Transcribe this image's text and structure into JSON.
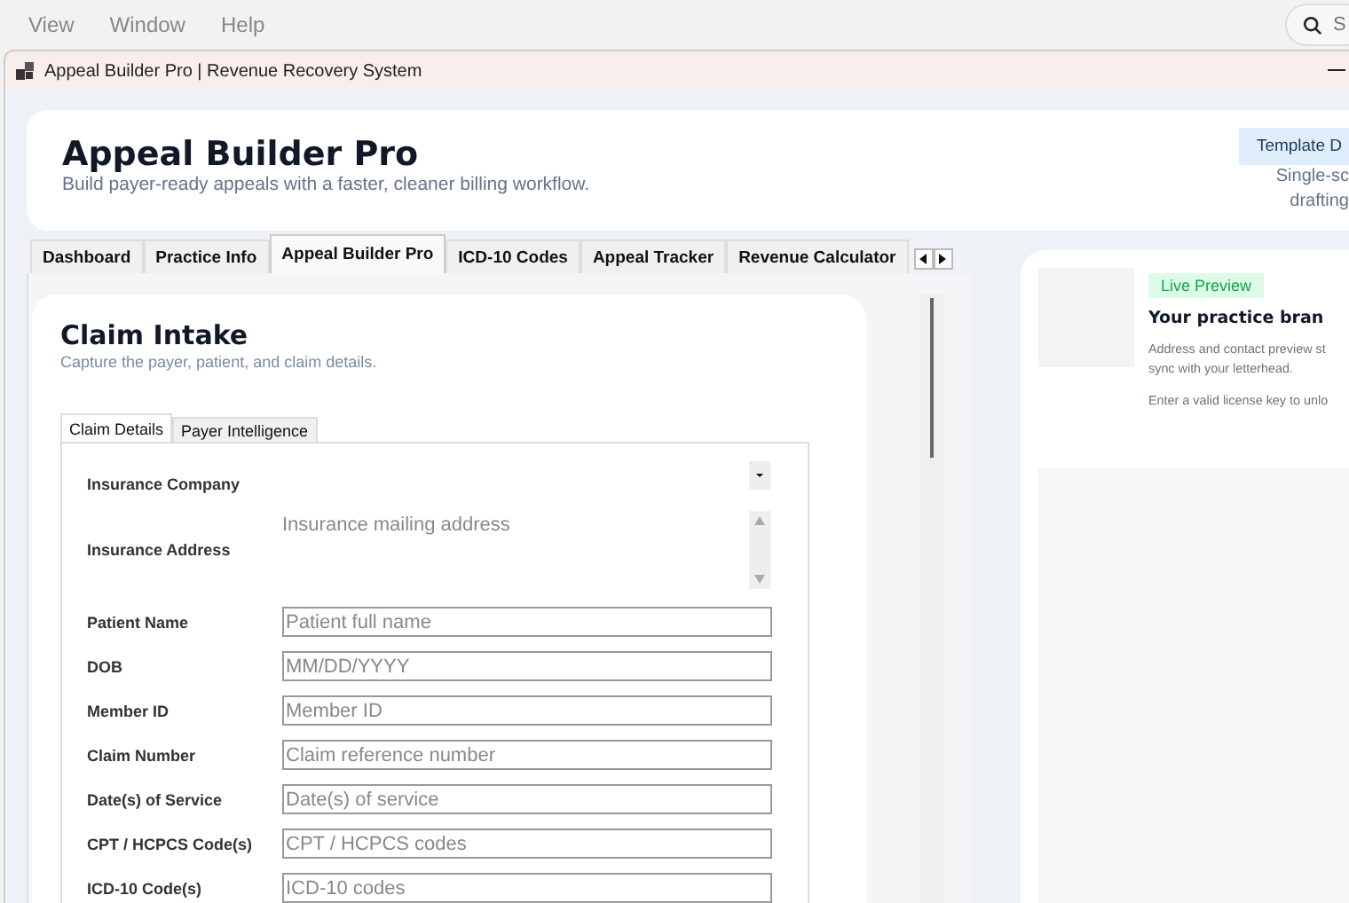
{
  "menu": [
    "View",
    "Window",
    "Help"
  ],
  "search": {
    "placeholder": "S"
  },
  "window": {
    "title": "Appeal Builder Pro | Revenue Recovery System"
  },
  "header": {
    "title": "Appeal Builder Pro",
    "subtitle": "Build payer-ready appeals with a faster, cleaner billing workflow.",
    "badge": "Template D",
    "notes": [
      "Single-sc",
      "drafting"
    ]
  },
  "tabs": [
    {
      "label": "Dashboard",
      "selected": false
    },
    {
      "label": "Practice Info",
      "selected": false
    },
    {
      "label": "Appeal Builder Pro",
      "selected": true
    },
    {
      "label": "ICD-10 Codes",
      "selected": false
    },
    {
      "label": "Appeal Tracker",
      "selected": false
    },
    {
      "label": "Revenue Calculator",
      "selected": false
    }
  ],
  "intake": {
    "title": "Claim Intake",
    "subtitle": "Capture the payer, patient, and claim details.",
    "subtabs": [
      {
        "label": "Claim Details",
        "selected": true
      },
      {
        "label": "Payer Intelligence",
        "selected": false
      }
    ],
    "fields": [
      {
        "label": "Insurance Company",
        "kind": "select"
      },
      {
        "label": "Insurance Address",
        "kind": "textarea",
        "placeholder": "Insurance mailing address"
      },
      {
        "label": "Patient Name",
        "kind": "text",
        "placeholder": "Patient full name"
      },
      {
        "label": "DOB",
        "kind": "text",
        "placeholder": "MM/DD/YYYY"
      },
      {
        "label": "Member ID",
        "kind": "text",
        "placeholder": "Member ID"
      },
      {
        "label": "Claim Number",
        "kind": "text",
        "placeholder": "Claim reference number"
      },
      {
        "label": "Date(s) of Service",
        "kind": "text",
        "placeholder": "Date(s) of service"
      },
      {
        "label": "CPT / HCPCS Code(s)",
        "kind": "text",
        "placeholder": "CPT / HCPCS codes"
      },
      {
        "label": "ICD-10 Code(s)",
        "kind": "text",
        "placeholder": "ICD-10 codes"
      }
    ]
  },
  "preview": {
    "badge": "Live Preview",
    "title": "Your practice bran",
    "lines": [
      "Address and contact preview st",
      "sync with your letterhead."
    ],
    "note": "Enter a valid license key to unlo"
  }
}
